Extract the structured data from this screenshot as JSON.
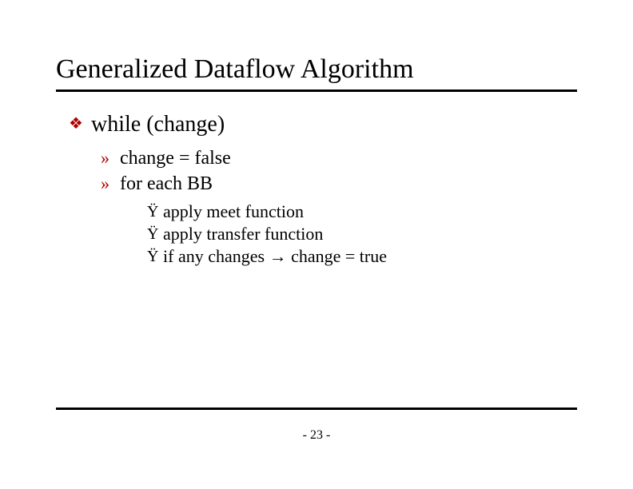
{
  "title": "Generalized Dataflow Algorithm",
  "bullets": {
    "lvl1_bullet": "❖",
    "lvl2_bullet": "»",
    "lvl3_bullet": "Ÿ"
  },
  "content": {
    "l1": "while (change)",
    "l2a": "change = false",
    "l2b": "for each BB",
    "l3a": "apply meet function",
    "l3b": "apply transfer function",
    "l3c_pre": "if any changes ",
    "l3c_arrow": "→",
    "l3c_post": " change = true"
  },
  "page_number": "- 23 -"
}
